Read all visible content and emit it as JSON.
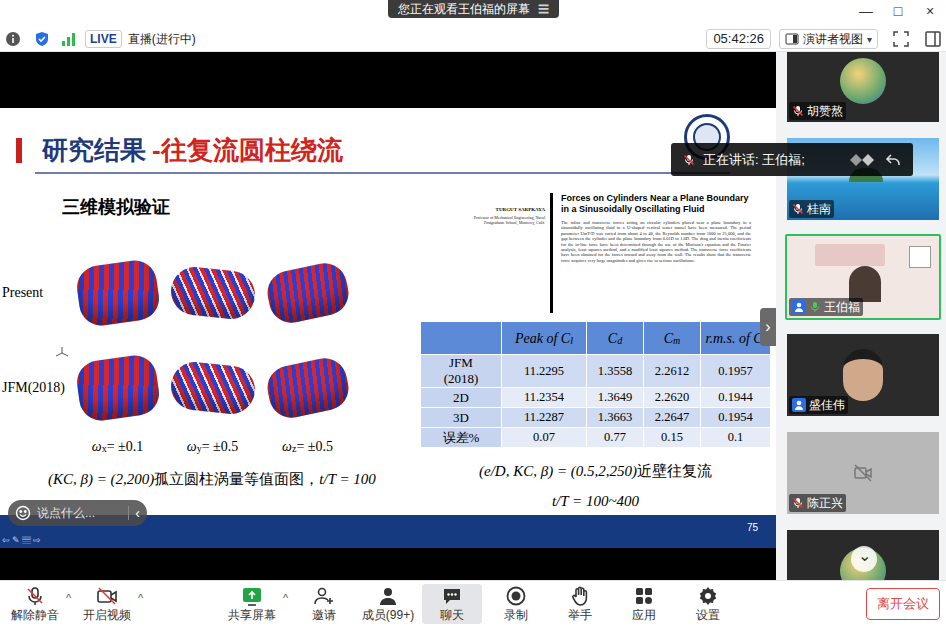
{
  "window": {
    "title": "您正在观看王伯福的屏幕",
    "title_icon": "☰",
    "controls": [
      "—",
      "□",
      "×"
    ]
  },
  "info_bar": {
    "live_badge": "LIVE",
    "live_status": "直播(进行中)",
    "timer": "05:42:26",
    "view_button": "演讲者视图",
    "view_caret": "▾"
  },
  "slide": {
    "title_main": "研究结果",
    "title_sub": "-往复流圆柱绕流",
    "section": "三维模拟验证",
    "figure_rows": [
      {
        "label": "Present"
      },
      {
        "label": "JFM(2018)"
      }
    ],
    "figure_labels": [
      {
        "symbol": "ω",
        "sub": "x",
        "value": " = ±0.1"
      },
      {
        "symbol": "ω",
        "sub": "y",
        "value": " = ±0.5"
      },
      {
        "symbol": "ω",
        "sub": "z",
        "value": " = ±0.5"
      }
    ],
    "figure_caption": {
      "math": "(KC, β) = (2,200)",
      "text": "孤立圆柱涡量等值面图，",
      "math2": "t/T = 100"
    },
    "paper": {
      "title": "Forces on Cylinders Near a Plane Boundary in a Sinusoidally Oscillating Fluid",
      "author": "TURGUT SARPKAYA",
      "affiliation": "Professor of Mechanical Engineering, Naval Postgraduate School, Monterey, Calif.",
      "abstract": "The inline and transverse forces acting on circular cylinders placed near a plane boundary in a sinusoidally oscillating fluid in a U-shaped vertical water tunnel have been measured. The period parameter UmT/D was varied from about 4 to 40, the Reynolds number from 1000 to 25,000, and the gap between the cylinder and the plane boundary from 0.01D to 1.0D. The drag and inertia coefficients for the in-line force have been determined through the use of the Morison's equation and the Fourier analysis, least squares method, and a modified least squares method. The transverse force coefficients have been obtained for the forces toward and away from the wall. The results show that the transverse force acquires very large magnitudes and gives rise to serious oscillations."
    },
    "table": {
      "columns": [
        {
          "base": "Peak of C",
          "sub": "l"
        },
        {
          "base": "C",
          "sub": "d"
        },
        {
          "base": "C",
          "sub": "m"
        },
        {
          "base": "r.m.s. of C",
          "sub": "l"
        }
      ],
      "rows": [
        {
          "label": "JFM\n(2018)",
          "values": [
            "11.2295",
            "1.3558",
            "2.2612",
            "0.1957"
          ]
        },
        {
          "label": "2D",
          "values": [
            "11.2354",
            "1.3649",
            "2.2620",
            "0.1944"
          ]
        },
        {
          "label": "3D",
          "values": [
            "11.2287",
            "1.3663",
            "2.2647",
            "0.1954"
          ]
        },
        {
          "label": "误差%",
          "values": [
            "0.07",
            "0.77",
            "0.15",
            "0.1"
          ]
        }
      ]
    },
    "captions": [
      {
        "math": "(e/D, KC, β) = (0.5,2,250)",
        "text": "近壁往复流"
      },
      {
        "math": "t/T = 100~400",
        "text": ""
      }
    ],
    "nav_icons": [
      "⇦",
      "✎",
      "▤",
      "⇨"
    ],
    "page_number": "75"
  },
  "chat_input": {
    "placeholder": "说点什么...",
    "collapse": "‹"
  },
  "speaking_banner": {
    "text": "正在讲话: 王伯福;"
  },
  "panel_toggle": "›",
  "participants": [
    {
      "name": "胡赞熬",
      "mic": "muted",
      "user_icon": false,
      "speaking": false,
      "kind": "avatar"
    },
    {
      "name": "桂南",
      "mic": "muted",
      "user_icon": false,
      "speaking": false,
      "kind": "scenery"
    },
    {
      "name": "王伯福",
      "mic": "on",
      "user_icon": true,
      "speaking": true,
      "kind": "video"
    },
    {
      "name": "盛佳伟",
      "mic": "none",
      "user_icon": true,
      "speaking": false,
      "kind": "face"
    },
    {
      "name": "陈正兴",
      "mic": "muted",
      "user_icon": false,
      "speaking": false,
      "kind": "off"
    },
    {
      "speaking": false,
      "kind": "avatar"
    }
  ],
  "scroll_button": "⌄",
  "toolbar": {
    "items": [
      {
        "label": "解除静音",
        "caret": "^",
        "selected": false
      },
      {
        "label": "开启视频",
        "caret": "^",
        "selected": false
      },
      {
        "label": "共享屏幕",
        "caret": "^",
        "selected": false
      },
      {
        "label": "邀请",
        "selected": false
      },
      {
        "label": "成员(99+)",
        "selected": false
      },
      {
        "label": "聊天",
        "selected": true
      },
      {
        "label": "录制",
        "selected": false
      },
      {
        "label": "举手",
        "selected": false
      },
      {
        "label": "应用",
        "selected": false
      },
      {
        "label": "设置",
        "selected": false
      }
    ],
    "leave_button": "离开会议"
  }
}
